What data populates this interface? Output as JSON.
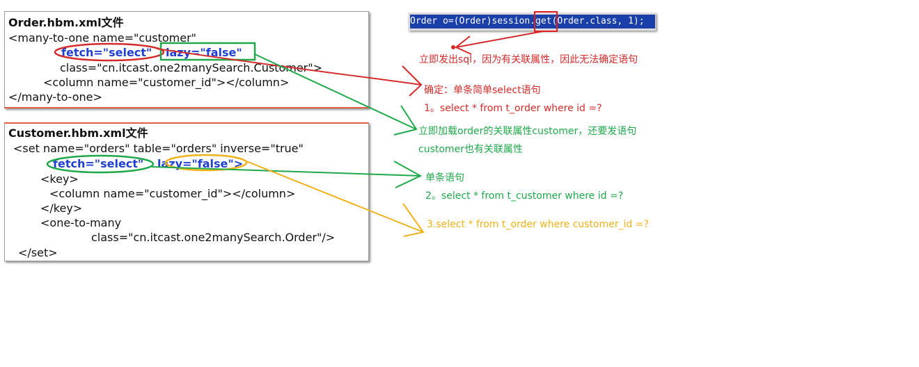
{
  "order_panel": {
    "title": "Order.hbm.xml文件",
    "line1": "<many-to-one name=\"customer\"",
    "fetch": "fetch=\"select\"",
    "lazy": "lazy=\"false\"",
    "line3": "class=\"cn.itcast.one2manySearch.Customer\">",
    "line4": "<column name=\"customer_id\"></column>",
    "line5": "</many-to-one>"
  },
  "customer_panel": {
    "title": "Customer.hbm.xml文件",
    "line1": "<set name=\"orders\" table=\"orders\" inverse=\"true\"",
    "fetch": "fetch=\"select\"",
    "lazy": "lazy=\"false\">",
    "line3": "<key>",
    "line4": "<column name=\"customer_id\"></column>",
    "line5": "</key>",
    "line6": "<one-to-many",
    "line7": "class=\"cn.itcast.one2manySearch.Order\"/>",
    "line8": "</set>"
  },
  "code_snippet": "Order o=(Order)session.get(Order.class, 1);",
  "notes": {
    "red1": "立即发出sql，因为有关联属性，因此无法确定语句",
    "red2": "确定：单条简单select语句",
    "red3": "1。select * from t_order where id =?",
    "green1": "立即加载order的关联属性customer，还要发语句",
    "green2": "customer也有关联属性",
    "green3": "单条语句",
    "green4": "2。select * from t_customer where id =?",
    "gold1": "3.select * from t_order where customer_id =?"
  },
  "colors": {
    "red": "#d42a2a",
    "green": "#1fa84a",
    "gold": "#f0b21a",
    "keyword_blue": "#1f3fd0",
    "code_background": "#1a3fa8"
  }
}
